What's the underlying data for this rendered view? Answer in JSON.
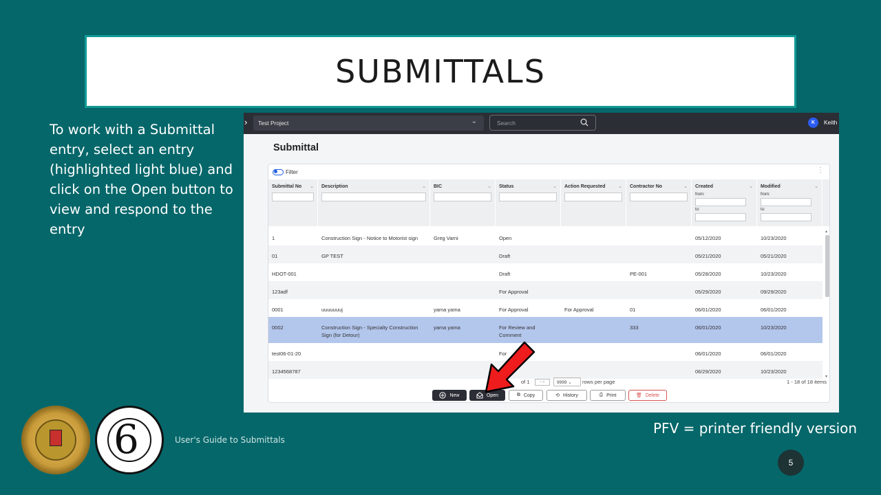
{
  "slide": {
    "title": "SUBMITTALS",
    "instructions": "To work with a Submittal entry, select an entry (highlighted light blue) and click on the Open button to view and respond to the entry",
    "footer_text": "User's Guide to Submittals",
    "note": "PFV = printer friendly version",
    "page_number": "5",
    "accent_color": "#05676a"
  },
  "app": {
    "project": "Test Project",
    "search_placeholder": "Search",
    "user_initial": "K",
    "user_name": "Keith",
    "page_title": "Submittal",
    "filter_label": "Filter",
    "columns": [
      "Submittal No",
      "Description",
      "BIC",
      "Status",
      "Action Requested",
      "Contractor No",
      "Created",
      "Modified"
    ],
    "from_label": "from:",
    "to_label": "to:",
    "rows": [
      {
        "no": "1",
        "desc": "Construction Sign - Notice to Motorist sign",
        "bic": "Greg Varni",
        "status": "Open",
        "action": "",
        "contractor": "",
        "created": "05/12/2020",
        "modified": "10/23/2020"
      },
      {
        "no": "01",
        "desc": "GP TEST",
        "bic": "",
        "status": "Draft",
        "action": "",
        "contractor": "",
        "created": "05/21/2020",
        "modified": "05/21/2020"
      },
      {
        "no": "HDOT-001",
        "desc": "",
        "bic": "",
        "status": "Draft",
        "action": "",
        "contractor": "PE-001",
        "created": "05/28/2020",
        "modified": "10/23/2020"
      },
      {
        "no": "123adf",
        "desc": "",
        "bic": "",
        "status": "For Approval",
        "action": "",
        "contractor": "",
        "created": "05/29/2020",
        "modified": "09/29/2020"
      },
      {
        "no": "0001",
        "desc": "uuuuuuuj",
        "bic": "yama yama",
        "status": "For Approval",
        "action": "For Approval",
        "contractor": "01",
        "created": "06/01/2020",
        "modified": "06/01/2020"
      },
      {
        "no": "0002",
        "desc": "Construction Sign - Specialty Construction Sign (for Detour)",
        "bic": "yama yama",
        "status": "For Review and Comment",
        "action": "",
        "contractor": "333",
        "created": "06/01/2020",
        "modified": "10/23/2020"
      },
      {
        "no": "test06-01-20",
        "desc": "",
        "bic": "",
        "status": "For",
        "action": "",
        "contractor": "",
        "created": "06/01/2020",
        "modified": "06/01/2020"
      },
      {
        "no": "1234568787",
        "desc": "",
        "bic": "",
        "status": "oval",
        "action": "",
        "contractor": "",
        "created": "06/29/2020",
        "modified": "10/23/2020"
      }
    ],
    "selected_row": "0002",
    "selected_color": "#b3c6ec",
    "pager": {
      "of": "of 1",
      "page_size": "9999",
      "rows_per_page": "rows per page",
      "count": "1 - 18 of 18 items"
    },
    "buttons": {
      "new": "New",
      "open": "Open",
      "copy": "Copy",
      "history": "History",
      "print": "Print",
      "delete": "Delete"
    }
  }
}
